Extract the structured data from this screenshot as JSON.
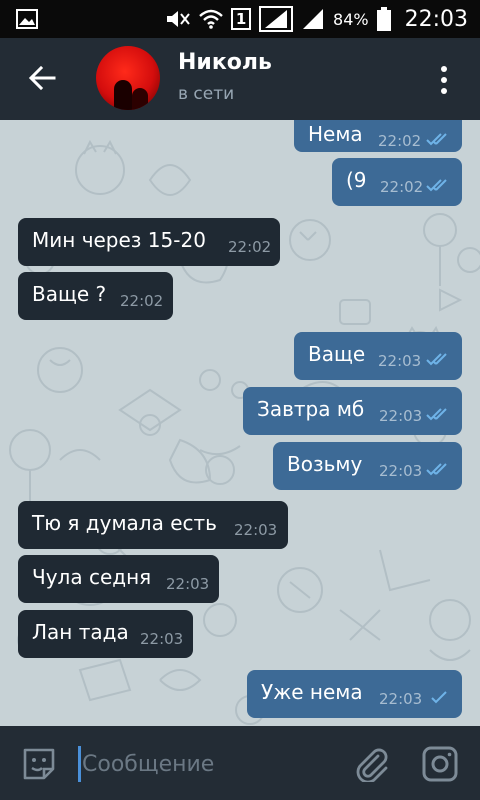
{
  "status_bar": {
    "battery_text": "84%",
    "time": "22:03",
    "signal_badge": "1"
  },
  "header": {
    "name": "Николь",
    "status": "в сети"
  },
  "messages": [
    {
      "dir": "out",
      "text": "Нема",
      "time": "22:02",
      "read": true
    },
    {
      "dir": "out",
      "text": "(9",
      "time": "22:02",
      "read": true
    },
    {
      "dir": "in",
      "text": "Мин через 15-20",
      "time": "22:02"
    },
    {
      "dir": "in",
      "text": "Ваще ?",
      "time": "22:02"
    },
    {
      "dir": "out",
      "text": "Ваще",
      "time": "22:03",
      "read": true
    },
    {
      "dir": "out",
      "text": "Завтра мб",
      "time": "22:03",
      "read": true
    },
    {
      "dir": "out",
      "text": "Возьму",
      "time": "22:03",
      "read": true
    },
    {
      "dir": "in",
      "text": "Тю я думала есть",
      "time": "22:03"
    },
    {
      "dir": "in",
      "text": "Чула седня",
      "time": "22:03"
    },
    {
      "dir": "in",
      "text": "Лан тада",
      "time": "22:03"
    },
    {
      "dir": "out",
      "text": "Уже нема",
      "time": "22:03",
      "read": false
    }
  ],
  "composer": {
    "placeholder": "Сообщение",
    "value": ""
  },
  "colors": {
    "app_bar": "#232c35",
    "outgoing_bubble": "#3d6a96",
    "incoming_bubble": "#1f2933",
    "check_color": "#6fb3e8"
  }
}
